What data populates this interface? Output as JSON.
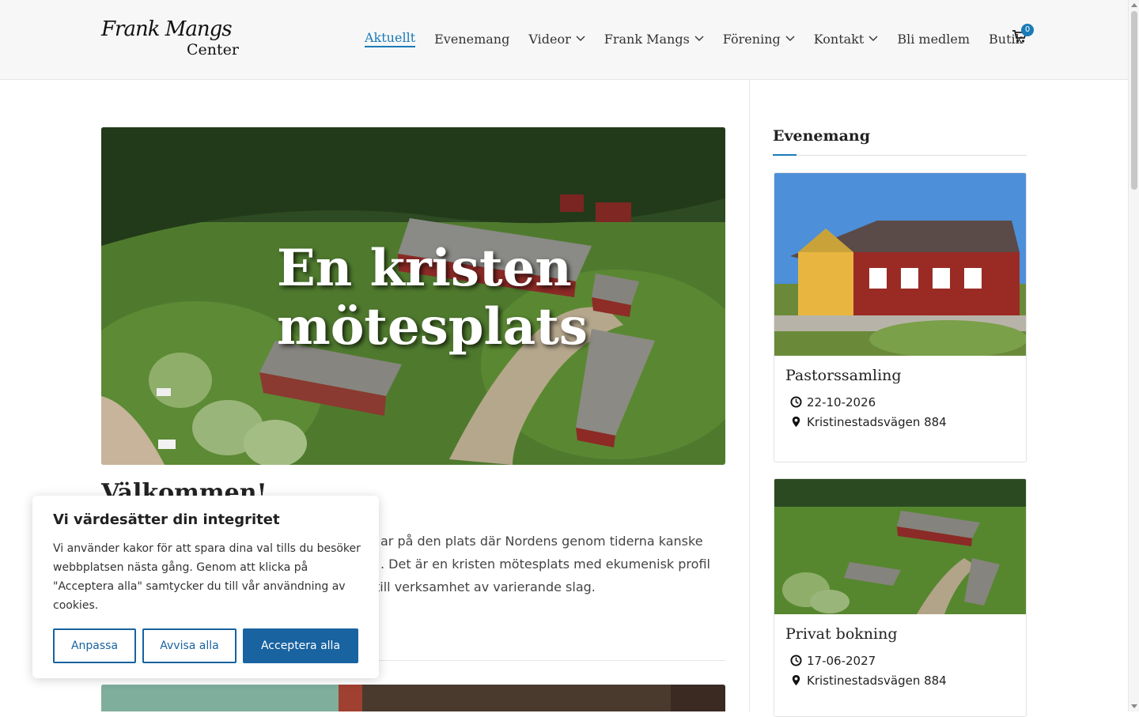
{
  "header": {
    "logo_line1": "Frank Mangs",
    "logo_line2": "Center",
    "nav": [
      {
        "label": "Aktuellt"
      },
      {
        "label": "Evenemang"
      },
      {
        "label": "Videor"
      },
      {
        "label": "Frank Mangs"
      },
      {
        "label": "Förening"
      },
      {
        "label": "Kontakt"
      },
      {
        "label": "Bli medlem"
      },
      {
        "label": "Butik"
      }
    ],
    "cart_count": "0"
  },
  "hero": {
    "title_line1": "En kristen",
    "title_line2": "mötesplats"
  },
  "main": {
    "welcome": "Välkommen!",
    "intro_line1": "ar på den plats där Nordens genom tiderna kanske",
    "intro_line2": ". Det är en kristen mötesplats med ekumenisk profil",
    "intro_line3": "till verksamhet av varierande slag."
  },
  "sidebar": {
    "title": "Evenemang",
    "events": [
      {
        "title": "Pastorssamling",
        "date": "22-10-2026",
        "place": "Kristinestadsvägen 884"
      },
      {
        "title": "Privat bokning",
        "date": "17-06-2027",
        "place": "Kristinestadsvägen 884"
      }
    ]
  },
  "cookie": {
    "title": "Vi värdesätter din integritet",
    "text": "Vi använder kakor för att spara dina val tills du besöker webbplatsen nästa gång. Genom att klicka på \"Acceptera alla\" samtycker du till vår användning av cookies.",
    "customize": "Anpassa",
    "reject": "Avvisa alla",
    "accept": "Acceptera alla"
  },
  "colors": {
    "accent": "#1a7ab8",
    "button": "#1863a0"
  }
}
